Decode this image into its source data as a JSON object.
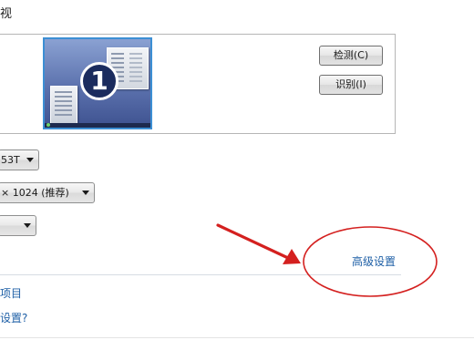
{
  "header": {
    "title": "视"
  },
  "monitor": {
    "number": "1"
  },
  "buttons": {
    "detect_label": "检测(C)",
    "identify_label": "识别(I)"
  },
  "display_select": {
    "value": "53T"
  },
  "resolution_select": {
    "value": "× 1024 (推荐)"
  },
  "orientation_select": {
    "value": ""
  },
  "links": {
    "advanced_settings": "高级设置",
    "items": "项目",
    "settings_question": "设置?"
  },
  "annotation": {
    "color": "#d4201f"
  }
}
